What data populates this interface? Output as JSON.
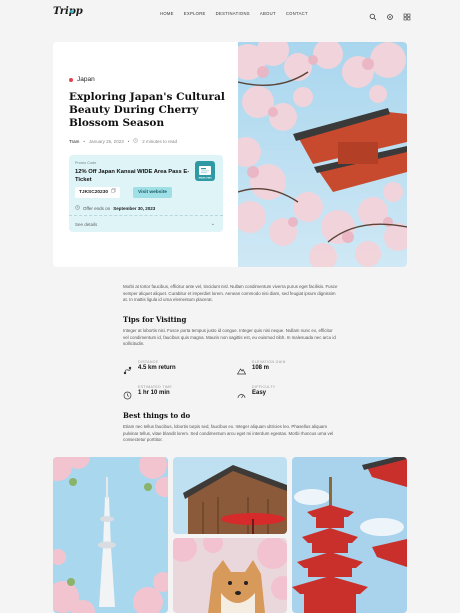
{
  "nav": {
    "logo": "Tripp",
    "menu": [
      "HOME",
      "EXPLORE",
      "DESTINATIONS",
      "ABOUT",
      "CONTACT"
    ],
    "icons": [
      "search-icon",
      "settings-icon",
      "grid-icon"
    ]
  },
  "hero": {
    "category": "Japan",
    "title": "Exploring Japan's Cultural Beauty During Cherry Blossom Season",
    "author": "Tram",
    "date": "January 26, 2023",
    "read_time": "2 minutes to read",
    "photo": "cherry-blossoms-and-red-pagoda-roof"
  },
  "promo": {
    "tag": "Promo Code",
    "name": "12% Off Japan Kansai WIDE Area Pass E-Ticket",
    "code": "TJKSC20230",
    "visit_label": "Visit website",
    "ends_label": "Offer ends on",
    "ends_date": "September 30, 2023",
    "details_label": "See details",
    "ticket_text": "TRAVEL PASS"
  },
  "article": {
    "intro": "Morbi at tortor faucibus, efficitur ante vel, tincidunt nisl. Nullam condimentum viverra purus eget facilisis. Fusce semper aliquet aliquet. Curabitur et imperdiet lorem. Aenean commodo nisi diam, sed feugiat ipsum dignissim at. In mattis ligula id urna elementum placerat.",
    "tips_heading": "Tips for Visiting",
    "tips_text": "Integer at lobortis nisi. Fusce porta tempus justo id congue. Integer quis nisi neque. Nullam nunc ex, efficitur vel condimentum id, faucibus quis magna. Mauris non sagittis est, eu euismod nibh. In malesuada nec arcu id sollicitudin.",
    "stats": [
      {
        "label": "DISTANCE",
        "value": "4.5 km return",
        "icon": "route-icon"
      },
      {
        "label": "ELEVATION GAIN",
        "value": "108 m",
        "icon": "mountain-icon"
      },
      {
        "label": "ESTIMATED TIME",
        "value": "1 hr 10 min",
        "icon": "clock-icon"
      },
      {
        "label": "DIFFICULTY",
        "value": "Easy",
        "icon": "gauge-icon"
      }
    ],
    "best_heading": "Best things to do",
    "best_text": "Etiam nec tellus faucibus, lobortis turpis sed, faucibus ex. Integer aliquam ultricies leo. Phasellus aliquam pulvinar tellus, vitae blandit lorem. Sed condimentum arcu eget mi interdum egestas. Morbi rhoncus urna vel consectetur porttitor."
  },
  "gallery": [
    "tokyo-skytree-with-blossoms",
    "wooden-house-red-umbrella",
    "shiba-dog-with-blossoms",
    "red-pagoda"
  ]
}
